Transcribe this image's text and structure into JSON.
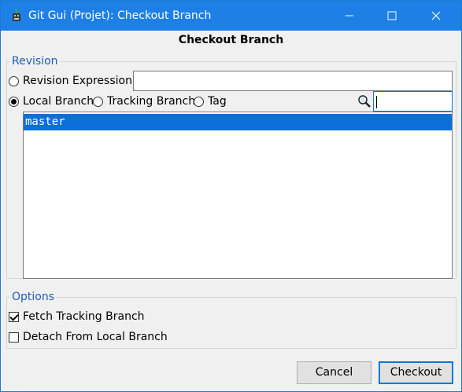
{
  "window": {
    "title": "Git Gui (Projet): Checkout Branch",
    "minimize_icon": "minimize-icon",
    "maximize_icon": "maximize-icon",
    "close_icon": "close-icon"
  },
  "dialog": {
    "heading": "Checkout Branch"
  },
  "revision": {
    "legend": "Revision",
    "expression_label": "Revision Expression:",
    "expression_value": "",
    "local_branch_label": "Local Branch",
    "tracking_branch_label": "Tracking Branch",
    "tag_label": "Tag",
    "selected_type": "local",
    "filter_value": "",
    "branches": [
      "master"
    ],
    "selected_branch": "master"
  },
  "options": {
    "legend": "Options",
    "fetch_tracking_label": "Fetch Tracking Branch",
    "fetch_tracking_checked": true,
    "detach_label": "Detach From Local Branch",
    "detach_checked": false
  },
  "buttons": {
    "cancel": "Cancel",
    "checkout": "Checkout"
  },
  "colors": {
    "titlebar": "#1e80e6",
    "selection": "#0a6fd8",
    "legend": "#1e5db8"
  }
}
